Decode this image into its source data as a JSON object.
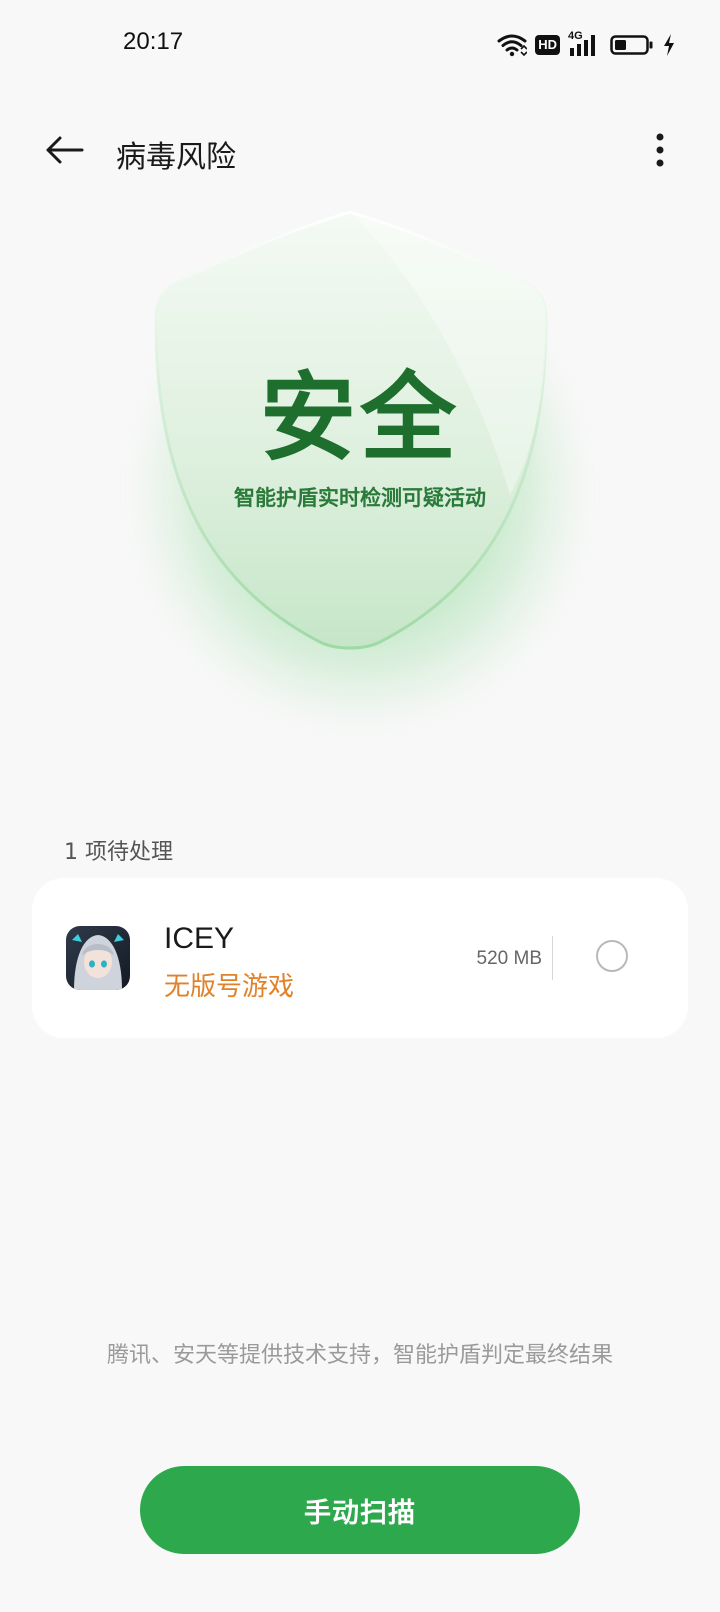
{
  "status_bar": {
    "time": "20:17",
    "icons": [
      "wifi-icon",
      "hd-icon",
      "4g-signal-icon",
      "battery-icon",
      "charging-icon"
    ],
    "hd_text": "HD",
    "network_text": "4G"
  },
  "header": {
    "title": "病毒风险",
    "back_icon": "arrow-left-icon",
    "more_icon": "more-vertical-icon"
  },
  "shield": {
    "status": "安全",
    "description": "智能护盾实时检测可疑活动",
    "accent_color": "#1e6e2d"
  },
  "pending": {
    "label": "1 项待处理",
    "items": [
      {
        "name": "ICEY",
        "tag": "无版号游戏",
        "size": "520 MB",
        "tag_color": "#e0822a",
        "selected": false
      }
    ]
  },
  "footer": {
    "support_text": "腾讯、安天等提供技术支持，智能护盾判定最终结果",
    "scan_button": "手动扫描",
    "button_color": "#2ea84d"
  }
}
